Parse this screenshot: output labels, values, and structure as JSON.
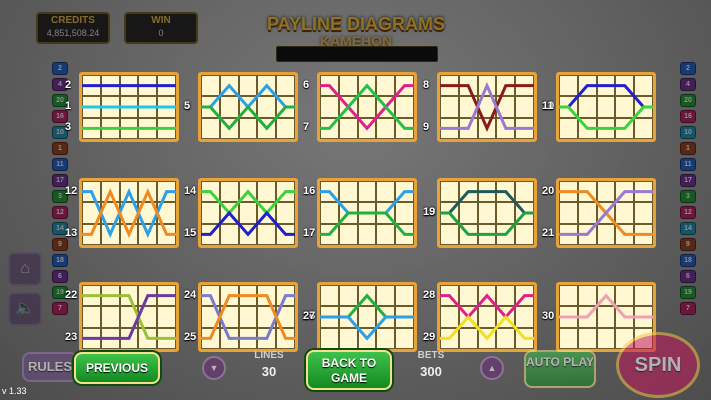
{
  "hud": {
    "credits_label": "CREDITS",
    "credits_value": "4,851,508.24",
    "win_label": "WIN",
    "win_value": "0"
  },
  "title": "PAYLINE DIAGRAMS",
  "game_logo": "KAMEHON",
  "paylines": [
    {
      "nums": [
        "2",
        "1",
        "3"
      ],
      "lines": [
        {
          "color": "#2020cc",
          "rows": [
            0,
            0,
            0,
            0,
            0
          ]
        },
        {
          "color": "#19c9e6",
          "rows": [
            1,
            1,
            1,
            1,
            1
          ]
        },
        {
          "color": "#3ad43a",
          "rows": [
            2,
            2,
            2,
            2,
            2
          ]
        }
      ]
    },
    {
      "nums": [
        "4",
        "5"
      ],
      "lines": [
        {
          "color": "#2aa0e8",
          "rows": [
            1,
            0,
            1,
            0,
            1
          ]
        },
        {
          "color": "#20b040",
          "rows": [
            1,
            2,
            1,
            2,
            1
          ]
        }
      ]
    },
    {
      "nums": [
        "6",
        "7"
      ],
      "lines": [
        {
          "color": "#e0208a",
          "rows": [
            0,
            1,
            2,
            1,
            0
          ]
        },
        {
          "color": "#22c04a",
          "rows": [
            2,
            1,
            0,
            1,
            2
          ]
        }
      ]
    },
    {
      "nums": [
        "8",
        "9"
      ],
      "lines": [
        {
          "color": "#8a1a1a",
          "rows": [
            0,
            0,
            2,
            0,
            0
          ]
        },
        {
          "color": "#9a7ad0",
          "rows": [
            2,
            2,
            0,
            2,
            2
          ]
        }
      ]
    },
    {
      "nums": [
        "10",
        "11"
      ],
      "lines": [
        {
          "color": "#2020cc",
          "rows": [
            1,
            0,
            0,
            0,
            1
          ]
        },
        {
          "color": "#3ad43a",
          "rows": [
            1,
            2,
            2,
            2,
            1
          ]
        }
      ]
    },
    {
      "nums": [
        "12",
        "13"
      ],
      "lines": [
        {
          "color": "#2aa0e8",
          "rows": [
            0,
            2,
            0,
            2,
            0
          ]
        },
        {
          "color": "#f08a20",
          "rows": [
            2,
            0,
            2,
            0,
            2
          ]
        }
      ]
    },
    {
      "nums": [
        "14",
        "15"
      ],
      "lines": [
        {
          "color": "#3ad43a",
          "rows": [
            0,
            1,
            0,
            1,
            0
          ]
        },
        {
          "color": "#2020cc",
          "rows": [
            2,
            1,
            2,
            1,
            2
          ]
        }
      ]
    },
    {
      "nums": [
        "16",
        "17"
      ],
      "lines": [
        {
          "color": "#2aa0e8",
          "rows": [
            0,
            1,
            1,
            1,
            0
          ]
        },
        {
          "color": "#20b040",
          "rows": [
            2,
            1,
            1,
            1,
            2
          ]
        }
      ]
    },
    {
      "nums": [
        "18",
        "19"
      ],
      "lines": [
        {
          "color": "#1e5a5a",
          "rows": [
            1,
            0,
            0,
            0,
            1
          ]
        },
        {
          "color": "#20a040",
          "rows": [
            1,
            2,
            2,
            2,
            1
          ]
        }
      ]
    },
    {
      "nums": [
        "20",
        "21"
      ],
      "lines": [
        {
          "color": "#f08a20",
          "rows": [
            0,
            0,
            1,
            2,
            2
          ]
        },
        {
          "color": "#9a7ad0",
          "rows": [
            2,
            2,
            1,
            0,
            0
          ]
        }
      ]
    },
    {
      "nums": [
        "22",
        "23"
      ],
      "lines": [
        {
          "color": "#9ac03a",
          "rows": [
            0,
            0,
            0,
            2,
            2
          ]
        },
        {
          "color": "#6a3aa0",
          "rows": [
            2,
            2,
            2,
            0,
            0
          ]
        }
      ]
    },
    {
      "nums": [
        "24",
        "25"
      ],
      "lines": [
        {
          "color": "#7a7ad0",
          "rows": [
            0,
            2,
            2,
            2,
            0
          ]
        },
        {
          "color": "#f08a20",
          "rows": [
            2,
            0,
            0,
            0,
            2
          ]
        }
      ]
    },
    {
      "nums": [
        "26",
        "27"
      ],
      "lines": [
        {
          "color": "#20b040",
          "rows": [
            1,
            1,
            0,
            1,
            1
          ]
        },
        {
          "color": "#2aa0e8",
          "rows": [
            1,
            1,
            2,
            1,
            1
          ]
        }
      ]
    },
    {
      "nums": [
        "28",
        "29"
      ],
      "lines": [
        {
          "color": "#e0208a",
          "rows": [
            0,
            1,
            0,
            1,
            0
          ]
        },
        {
          "color": "#f0e020",
          "rows": [
            2,
            1,
            2,
            1,
            2
          ]
        }
      ]
    },
    {
      "nums": [
        "30"
      ],
      "lines": [
        {
          "color": "#f0a0b0",
          "rows": [
            1,
            1,
            0,
            1,
            1
          ]
        }
      ]
    }
  ],
  "side_numbers_left": [
    "2",
    "4",
    "20",
    "16",
    "10",
    "1",
    "11",
    "17",
    "3",
    "12",
    "14",
    "9",
    "18",
    "6",
    "19",
    "7"
  ],
  "side_numbers_right": [
    "2",
    "4",
    "20",
    "16",
    "10",
    "1",
    "11",
    "17",
    "3",
    "12",
    "14",
    "9",
    "18",
    "6",
    "19",
    "7"
  ],
  "bottom": {
    "rules_label": "RULES",
    "previous_label": "PREVIOUS",
    "lines_label": "LINES",
    "lines_value": "30",
    "back_label": "BACK TO GAME",
    "bets_label": "BETS",
    "bets_value": "300",
    "auto_play_label": "AUTO PLAY",
    "spin_label": "SPIN",
    "minus_icon": "▼",
    "plus_icon": "▲"
  },
  "version": "v 1.33",
  "side_icons": {
    "home": "home-icon",
    "sound": "speaker-mute-icon"
  }
}
